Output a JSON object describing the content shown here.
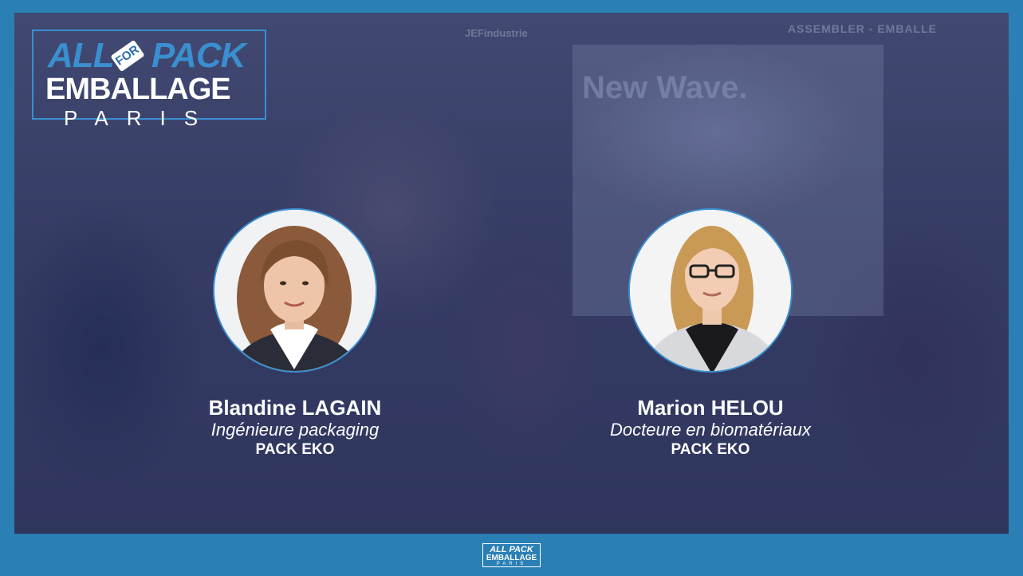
{
  "background": {
    "sign_left": "JEFindustrie",
    "sign_right": "ASSEMBLER - EMBALLE",
    "panel_text": "New Wave."
  },
  "logo": {
    "all": "ALL",
    "for": "FOR",
    "pack": "PACK",
    "emballage": "EMBALLAGE",
    "paris": "PARIS"
  },
  "speakers": [
    {
      "name": "Blandine LAGAIN",
      "role": "Ingénieure packaging",
      "company": "PACK EKO"
    },
    {
      "name": "Marion HELOU",
      "role": "Docteure en biomatériaux",
      "company": "PACK EKO"
    }
  ],
  "footer_logo": {
    "top": "ALL PACK",
    "mid": "EMBALLAGE",
    "bot": "PARIS"
  },
  "colors": {
    "frame": "#2a7fb5",
    "accent": "#3a8fd0",
    "text": "#ffffff"
  }
}
